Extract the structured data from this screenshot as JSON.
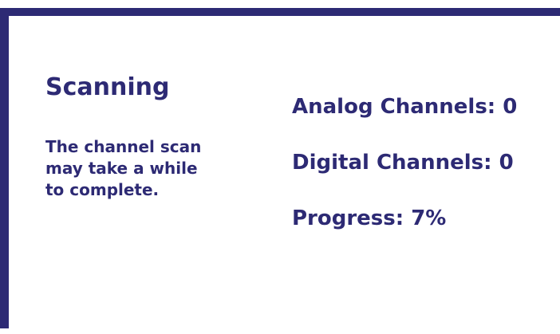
{
  "scan": {
    "title": "Scanning",
    "description_lines": [
      "The channel scan",
      "may take a while",
      "to complete."
    ],
    "analog_channels": "Analog Channels: 0",
    "digital_channels": "Digital Channels: 0",
    "progress": "Progress: 7%"
  },
  "colors": {
    "accent": "#2d2a74",
    "background": "#ffffff"
  }
}
